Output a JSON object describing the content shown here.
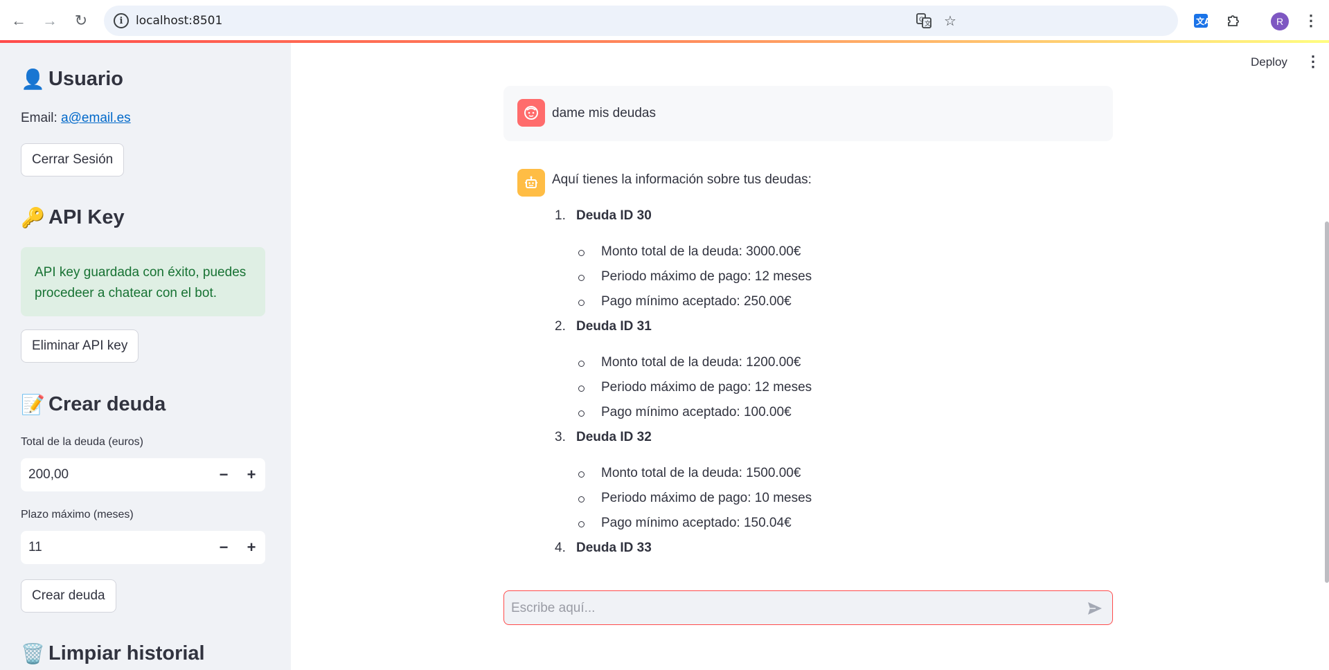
{
  "browser": {
    "url": "localhost:8501",
    "profile_initial": "R"
  },
  "header": {
    "deploy_label": "Deploy"
  },
  "sidebar": {
    "usuario": {
      "emoji": "👤",
      "title": "Usuario",
      "email_label": "Email:",
      "email_value": "a@email.es",
      "logout_label": "Cerrar Sesión"
    },
    "api_key": {
      "emoji": "🔑",
      "title": "API Key",
      "success_message": "API key guardada con éxito, puedes procedeer a chatear con el bot.",
      "delete_label": "Eliminar API key"
    },
    "crear_deuda": {
      "emoji": "📝",
      "title": "Crear deuda",
      "total_label": "Total de la deuda (euros)",
      "total_value": "200,00",
      "plazo_label": "Plazo máximo (meses)",
      "plazo_value": "11",
      "minus": "−",
      "plus": "+",
      "submit_label": "Crear deuda"
    },
    "limpiar": {
      "emoji": "🗑️",
      "title": "Limpiar historial"
    }
  },
  "chat": {
    "user_message": "dame mis deudas",
    "bot_intro": "Aquí tienes la información sobre tus deudas:",
    "debts": [
      {
        "num": "1.",
        "title": "Deuda ID 30",
        "details": [
          "Monto total de la deuda: 3000.00€",
          "Periodo máximo de pago: 12 meses",
          "Pago mínimo aceptado: 250.00€"
        ]
      },
      {
        "num": "2.",
        "title": "Deuda ID 31",
        "details": [
          "Monto total de la deuda: 1200.00€",
          "Periodo máximo de pago: 12 meses",
          "Pago mínimo aceptado: 100.00€"
        ]
      },
      {
        "num": "3.",
        "title": "Deuda ID 32",
        "details": [
          "Monto total de la deuda: 1500.00€",
          "Periodo máximo de pago: 10 meses",
          "Pago mínimo aceptado: 150.04€"
        ]
      },
      {
        "num": "4.",
        "title": "Deuda ID 33",
        "details": []
      }
    ],
    "input_placeholder": "Escribe aquí..."
  }
}
